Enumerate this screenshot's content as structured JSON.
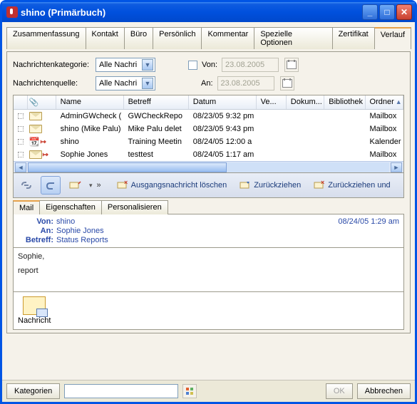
{
  "window": {
    "title": "shino (Primärbuch)"
  },
  "tabs": {
    "items": [
      "Zusammenfassung",
      "Kontakt",
      "Büro",
      "Persönlich",
      "Kommentar",
      "Spezielle Optionen",
      "Zertifikat",
      "Verlauf"
    ],
    "active": "Verlauf"
  },
  "filters": {
    "kategorie_label": "Nachrichtenkategorie:",
    "kategorie_value": "Alle Nachri",
    "quelle_label": "Nachrichtenquelle:",
    "quelle_value": "Alle Nachri",
    "von_label": "Von:",
    "von_date": "23.08.2005",
    "an_label": "An:",
    "an_date": "23.08.2005"
  },
  "table": {
    "headers": {
      "name": "Name",
      "betreff": "Betreff",
      "datum": "Datum",
      "ve": "Ve...",
      "dok": "Dokum...",
      "bib": "Bibliothek",
      "ord": "Ordner"
    },
    "rows": [
      {
        "name": "AdminGWcheck (",
        "betreff": "GWCheckRepo",
        "datum": "08/23/05 9:32 pm",
        "ord": "Mailbox"
      },
      {
        "name": "shino (Mike Palu)",
        "betreff": "Mike Palu delet",
        "datum": "08/23/05 9:43 pm",
        "ord": "Mailbox"
      },
      {
        "name": "shino",
        "betreff": "Training Meetin",
        "datum": "08/24/05 12:00 a",
        "ord": "Kalender"
      },
      {
        "name": "Sophie Jones",
        "betreff": "testtest",
        "datum": "08/24/05 1:17 am",
        "ord": "Mailbox"
      }
    ]
  },
  "toolbar": {
    "del_label": "Ausgangsnachricht löschen",
    "retract_label": "Zurückziehen",
    "retractand_label": "Zurückziehen und"
  },
  "msgtabs": {
    "items": [
      "Mail",
      "Eigenschaften",
      "Personalisieren"
    ],
    "active": "Mail"
  },
  "message": {
    "von_k": "Von:",
    "von_v": "shino",
    "an_k": "An:",
    "an_v": "Sophie Jones",
    "betreff_k": "Betreff:",
    "betreff_v": "Status Reports",
    "timestamp": "08/24/05 1:29 am",
    "body_line1": "Sophie,",
    "body_line2": "report",
    "attachment_label": "Nachricht"
  },
  "footer": {
    "kategorien": "Kategorien",
    "ok": "OK",
    "abbrechen": "Abbrechen"
  }
}
